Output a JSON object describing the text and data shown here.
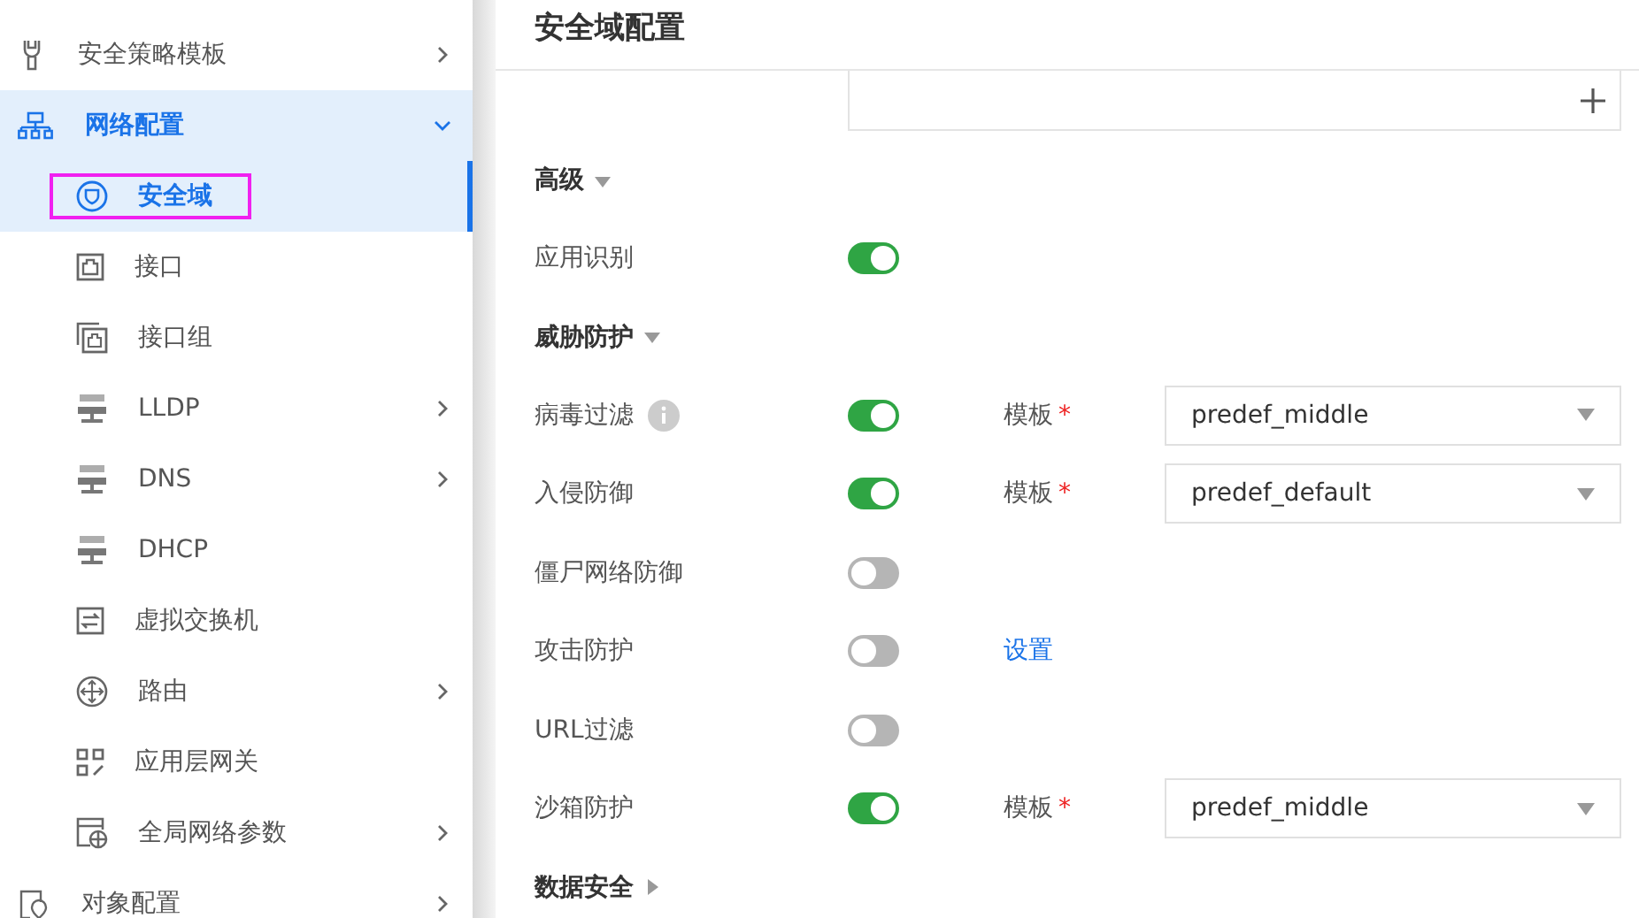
{
  "sidebar": {
    "items": [
      {
        "label": "安全策略模板",
        "has_arrow": true,
        "expanded": false
      },
      {
        "label": "网络配置",
        "has_arrow": true,
        "expanded": true,
        "children": [
          {
            "label": "安全域",
            "selected": true,
            "outlined": true,
            "has_arrow": false
          },
          {
            "label": "接口",
            "selected": false,
            "outlined": false,
            "has_arrow": false
          },
          {
            "label": "接口组",
            "selected": false,
            "outlined": false,
            "has_arrow": false
          },
          {
            "label": "LLDP",
            "selected": false,
            "outlined": false,
            "has_arrow": true
          },
          {
            "label": "DNS",
            "selected": false,
            "outlined": false,
            "has_arrow": true
          },
          {
            "label": "DHCP",
            "selected": false,
            "outlined": false,
            "has_arrow": false
          },
          {
            "label": "虚拟交换机",
            "selected": false,
            "outlined": false,
            "has_arrow": false
          },
          {
            "label": "路由",
            "selected": false,
            "outlined": false,
            "has_arrow": true
          },
          {
            "label": "应用层网关",
            "selected": false,
            "outlined": false,
            "has_arrow": false
          },
          {
            "label": "全局网络参数",
            "selected": false,
            "outlined": false,
            "has_arrow": true
          }
        ]
      },
      {
        "label": "对象配置",
        "has_arrow": true,
        "expanded": false
      }
    ]
  },
  "page": {
    "title": "安全域配置",
    "sections": [
      {
        "title": "高级",
        "expanded": true,
        "rows": [
          {
            "label": "应用识别",
            "on": true
          }
        ]
      },
      {
        "title": "威胁防护",
        "expanded": true,
        "rows": [
          {
            "label": "病毒过滤",
            "info": true,
            "on": true,
            "template": {
              "label": "模板",
              "required_mark": "*",
              "value": "predef_middle"
            }
          },
          {
            "label": "入侵防御",
            "on": true,
            "template": {
              "label": "模板",
              "required_mark": "*",
              "value": "predef_default"
            }
          },
          {
            "label": "僵尸网络防御",
            "on": false
          },
          {
            "label": "攻击防护",
            "on": false,
            "link": "设置"
          },
          {
            "label": "URL过滤",
            "on": false
          },
          {
            "label": "沙箱防护",
            "on": true,
            "template": {
              "label": "模板",
              "required_mark": "*",
              "value": "predef_middle"
            }
          }
        ]
      },
      {
        "title": "数据安全",
        "expanded": false
      }
    ]
  }
}
